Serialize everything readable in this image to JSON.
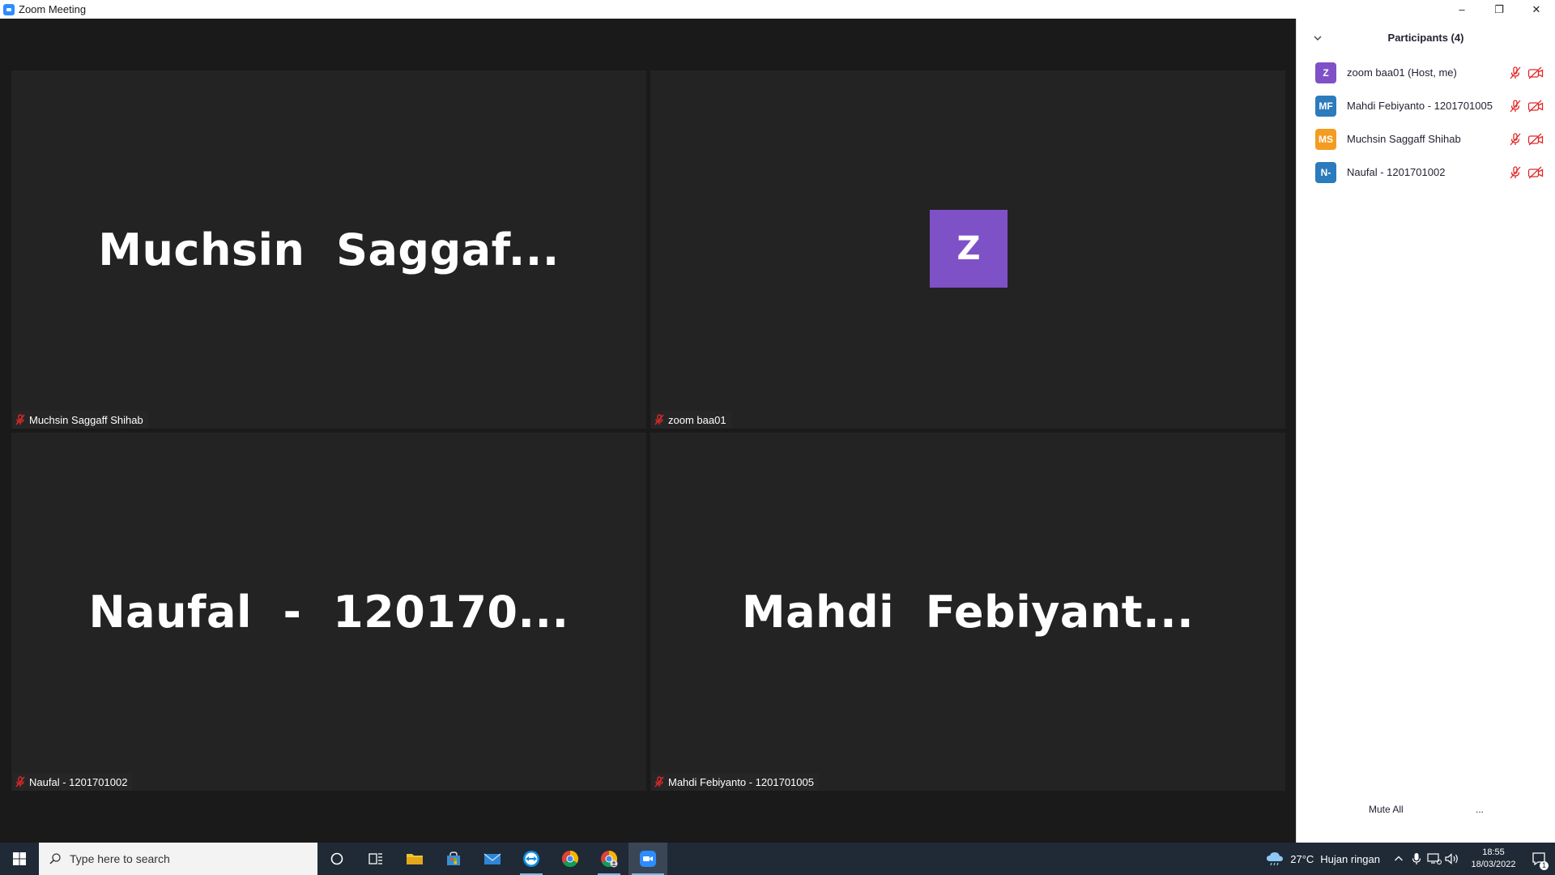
{
  "window": {
    "title": "Zoom Meeting",
    "minimize": "–",
    "restore": "❐",
    "close": "✕"
  },
  "tiles": [
    {
      "big_text": "Muchsin  Saggaf...",
      "label": "Muchsin Saggaff Shihab"
    },
    {
      "avatar_letter": "Z",
      "label": "zoom baa01"
    },
    {
      "big_text": "Naufal  -  120170...",
      "label": "Naufal - 1201701002"
    },
    {
      "big_text": "Mahdi  Febiyant...",
      "label": "Mahdi Febiyanto - 1201701005"
    }
  ],
  "participants_panel": {
    "title": "Participants (4)",
    "participants": [
      {
        "initials": "Z",
        "name": "zoom baa01 (Host, me)",
        "color": "#7f51c7"
      },
      {
        "initials": "MF",
        "name": "Mahdi Febiyanto - 1201701005",
        "color": "#2b7bbd"
      },
      {
        "initials": "MS",
        "name": "Muchsin Saggaff Shihab",
        "color": "#f39c1f"
      },
      {
        "initials": "N-",
        "name": "Naufal - 1201701002",
        "color": "#2b7bbd"
      }
    ],
    "mute_all": "Mute All",
    "more": "..."
  },
  "taskbar": {
    "search_placeholder": "Type here to search",
    "weather_temp": "27°C",
    "weather_desc": "Hujan ringan",
    "time": "18:55",
    "date": "18/03/2022",
    "notification_count": "1"
  },
  "colors": {
    "mute_red": "#e02828",
    "tile_bg": "#232323",
    "taskbar_bg": "#1f2a36"
  }
}
